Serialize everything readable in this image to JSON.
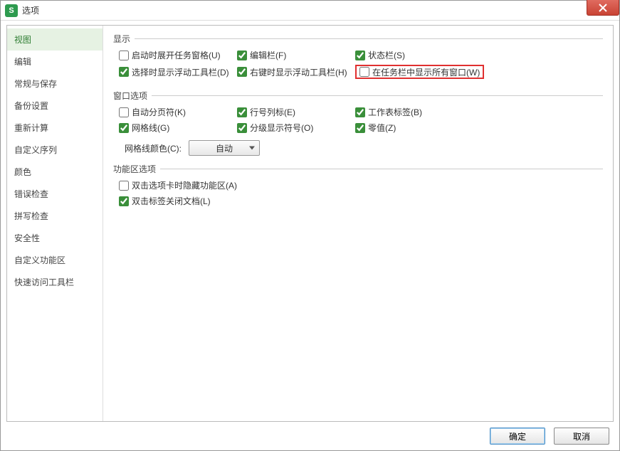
{
  "window": {
    "title": "选项"
  },
  "sidebar": {
    "items": [
      {
        "label": "视图",
        "active": true
      },
      {
        "label": "编辑"
      },
      {
        "label": "常规与保存"
      },
      {
        "label": "备份设置"
      },
      {
        "label": "重新计算"
      },
      {
        "label": "自定义序列"
      },
      {
        "label": "颜色"
      },
      {
        "label": "错误检查"
      },
      {
        "label": "拼写检查"
      },
      {
        "label": "安全性"
      },
      {
        "label": "自定义功能区"
      },
      {
        "label": "快速访问工具栏"
      }
    ]
  },
  "sections": {
    "display": {
      "title": "显示",
      "items": [
        {
          "label": "启动时展开任务窗格(U)",
          "checked": false
        },
        {
          "label": "编辑栏(F)",
          "checked": true
        },
        {
          "label": "状态栏(S)",
          "checked": true
        },
        {
          "label": "选择时显示浮动工具栏(D)",
          "checked": true
        },
        {
          "label": "右键时显示浮动工具栏(H)",
          "checked": true
        },
        {
          "label": "在任务栏中显示所有窗口(W)",
          "checked": false,
          "highlight": true
        }
      ]
    },
    "windowopt": {
      "title": "窗口选项",
      "items": [
        {
          "label": "自动分页符(K)",
          "checked": false
        },
        {
          "label": "行号列标(E)",
          "checked": true
        },
        {
          "label": "工作表标签(B)",
          "checked": true
        },
        {
          "label": "网格线(G)",
          "checked": true
        },
        {
          "label": "分级显示符号(O)",
          "checked": true
        },
        {
          "label": "零值(Z)",
          "checked": true
        }
      ],
      "gridcolor_label": "网格线颜色(C):",
      "gridcolor_value": "自动"
    },
    "ribbon": {
      "title": "功能区选项",
      "items": [
        {
          "label": "双击选项卡时隐藏功能区(A)",
          "checked": false
        },
        {
          "label": "双击标签关闭文档(L)",
          "checked": true
        }
      ]
    }
  },
  "buttons": {
    "ok": "确定",
    "cancel": "取消"
  }
}
